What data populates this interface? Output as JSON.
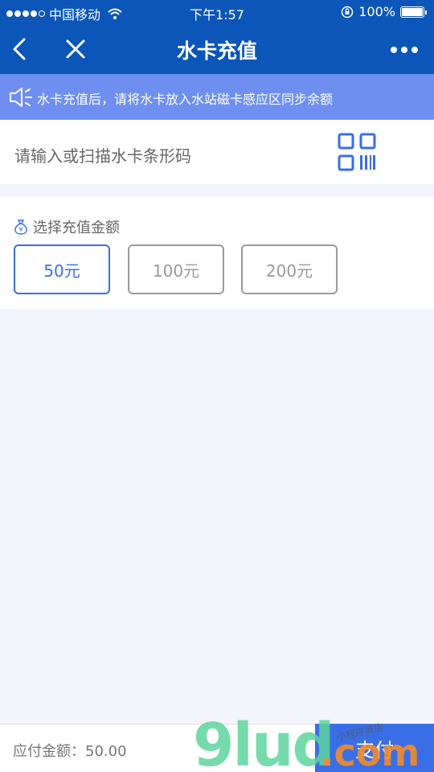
{
  "status_bar": {
    "carrier": "中国移动",
    "time": "下午1:57",
    "battery": "100%",
    "battery_level": 1.0
  },
  "nav": {
    "title": "水卡充值",
    "icons": {
      "back": "chevron-left-icon",
      "close": "close-icon",
      "more": "more-dots-icon"
    }
  },
  "notice": {
    "text": "水卡充值后，请将水卡放入水站磁卡感应区同步余额",
    "icon": "speaker-icon"
  },
  "scan": {
    "placeholder": "请输入或扫描水卡条形码",
    "icon": "qr-scan-icon"
  },
  "amount": {
    "label": "选择充值金额",
    "icon": "money-bag-icon",
    "options": [
      {
        "label": "50元",
        "selected": true
      },
      {
        "label": "100元",
        "selected": false
      },
      {
        "label": "200元",
        "selected": false
      }
    ]
  },
  "footer": {
    "due": "应付金额：50.00",
    "pay_label": "支付"
  },
  "watermark": {
    "text": "9lud.com",
    "subtext": "小程序商店"
  },
  "colors": {
    "header_blue": "#0b56b8",
    "notice_blue": "#6e8ff0",
    "accent_blue": "#3a6ee6",
    "page_bg": "#f3f4fc"
  }
}
